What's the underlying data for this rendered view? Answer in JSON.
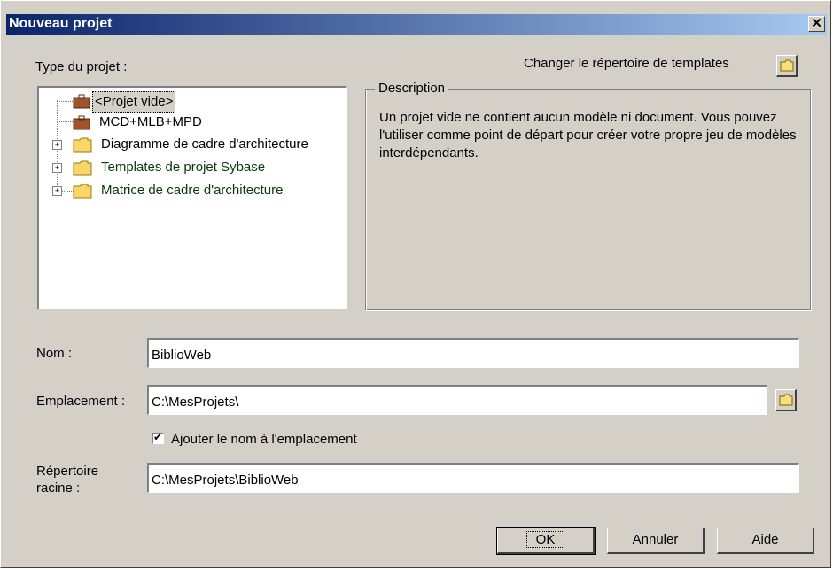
{
  "window": {
    "title": "Nouveau projet",
    "close_symbol": "✕"
  },
  "project_type": {
    "label": "Type du projet :",
    "items": [
      {
        "label": "<Projet vide>",
        "icon": "briefcase-icon",
        "selected": true
      },
      {
        "label": "MCD+MLB+MPD",
        "icon": "briefcase-icon"
      },
      {
        "label": "Diagramme de cadre d'architecture",
        "icon": "folder-icon",
        "expandable": true
      },
      {
        "label": "Templates de projet Sybase",
        "icon": "folder-icon",
        "expandable": true
      },
      {
        "label": "Matrice de cadre d'architecture",
        "icon": "folder-icon",
        "expandable": true
      }
    ]
  },
  "templates": {
    "change_label": "Changer le répertoire de templates",
    "icon": "folder-icon"
  },
  "description": {
    "legend": "Description",
    "text": "Un projet vide ne contient aucun modèle ni document. Vous pouvez l'utiliser comme point de départ pour créer votre propre jeu de modèles interdépendants."
  },
  "form": {
    "nom_label": "Nom :",
    "nom_value": "BiblioWeb",
    "emplacement_label": "Emplacement :",
    "emplacement_value": "C:\\MesProjets\\",
    "add_name_label": "Ajouter le nom à l'emplacement",
    "add_name_checked": true,
    "check_symbol": "✔",
    "racine_label_line1": "Répertoire",
    "racine_label_line2": "racine :",
    "racine_value": "C:\\MesProjets\\BiblioWeb"
  },
  "buttons": {
    "ok": "OK",
    "cancel": "Annuler",
    "help": "Aide"
  },
  "colors": {
    "titlebar_start": "#0a246a",
    "titlebar_end": "#a6caf0",
    "face": "#d4d0c8"
  }
}
